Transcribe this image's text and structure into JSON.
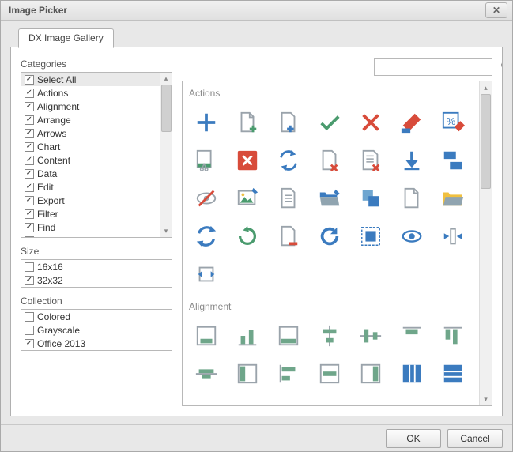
{
  "window": {
    "title": "Image Picker"
  },
  "tabs": [
    {
      "label": "DX Image Gallery"
    }
  ],
  "search": {
    "placeholder": ""
  },
  "categories": {
    "label": "Categories",
    "items": [
      {
        "label": "Select All",
        "checked": true,
        "header": true
      },
      {
        "label": "Actions",
        "checked": true
      },
      {
        "label": "Alignment",
        "checked": true
      },
      {
        "label": "Arrange",
        "checked": true
      },
      {
        "label": "Arrows",
        "checked": true
      },
      {
        "label": "Chart",
        "checked": true
      },
      {
        "label": "Content",
        "checked": true
      },
      {
        "label": "Data",
        "checked": true
      },
      {
        "label": "Edit",
        "checked": true
      },
      {
        "label": "Export",
        "checked": true
      },
      {
        "label": "Filter",
        "checked": true
      },
      {
        "label": "Find",
        "checked": true
      },
      {
        "label": "Format",
        "checked": true
      }
    ]
  },
  "size": {
    "label": "Size",
    "items": [
      {
        "label": "16x16",
        "checked": false
      },
      {
        "label": "32x32",
        "checked": true
      }
    ]
  },
  "collection": {
    "label": "Collection",
    "items": [
      {
        "label": "Colored",
        "checked": false
      },
      {
        "label": "Grayscale",
        "checked": false
      },
      {
        "label": "Office 2013",
        "checked": true
      }
    ]
  },
  "gallery": {
    "groups": [
      {
        "title": "Actions"
      },
      {
        "title": "Alignment"
      }
    ]
  },
  "buttons": {
    "ok": "OK",
    "cancel": "Cancel"
  }
}
